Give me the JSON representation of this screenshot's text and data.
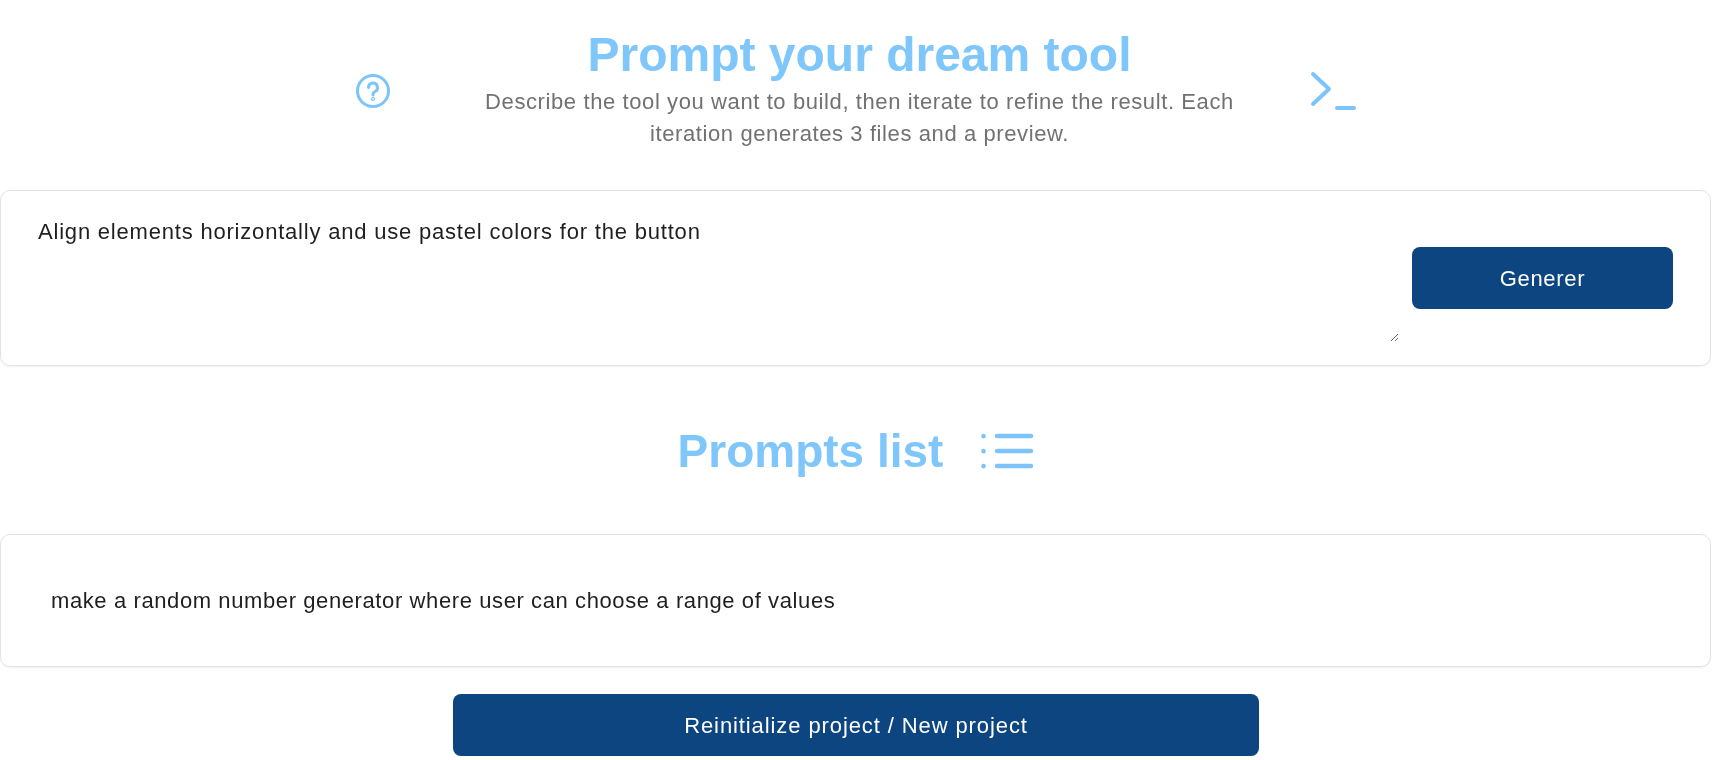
{
  "header": {
    "title": "Prompt your dream tool",
    "subtitle": "Describe the tool you want to build, then iterate to refine the result. Each iteration generates 3 files and a preview."
  },
  "prompt_form": {
    "value": "Align elements horizontally and use pastel colors for the button",
    "submit_button": "Generer"
  },
  "prompts_list": {
    "title": "Prompts list",
    "items": [
      "make a random number generator where user can choose a range of values"
    ]
  },
  "reset_button": "Reinitialize project / New project"
}
